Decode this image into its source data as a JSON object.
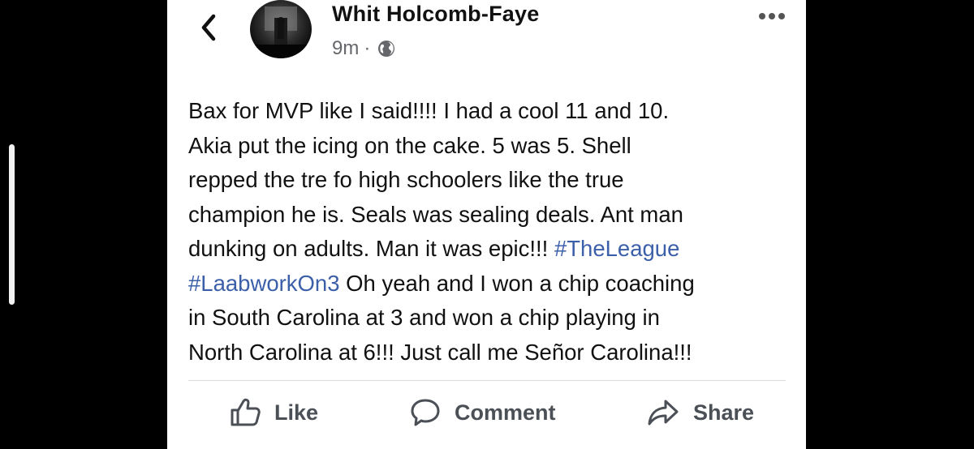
{
  "post": {
    "author": "Whit Holcomb-Faye",
    "time": "9m",
    "separator": "·",
    "lines": [
      [
        {
          "t": "Bax for MVP like I said!!!!  I had a cool 11 and 10."
        }
      ],
      [
        {
          "t": "Akia put the icing on the cake.  5 was 5. Shell"
        }
      ],
      [
        {
          "t": "repped the tre fo high schoolers like the true"
        }
      ],
      [
        {
          "t": "champion he is.  Seals was sealing deals. Ant man"
        }
      ],
      [
        {
          "t": "dunking on adults.  Man it was epic!!!  "
        },
        {
          "t": "#TheLeague",
          "tag": true
        }
      ],
      [
        {
          "t": "#LaabworkOn3",
          "tag": true
        },
        {
          "t": " Oh yeah and I won a chip coaching"
        }
      ],
      [
        {
          "t": "in South Carolina at 3 and won a chip playing in"
        }
      ],
      [
        {
          "t": "North Carolina at 6!!! Just call me Señor Carolina!!!"
        }
      ]
    ]
  },
  "actions": {
    "like": "Like",
    "comment": "Comment",
    "share": "Share"
  },
  "icons": {
    "back": "chevron-left-icon",
    "privacy": "globe-icon",
    "more": "more-horizontal-icon",
    "like": "thumbs-up-icon",
    "comment": "comment-bubble-icon",
    "share": "share-arrow-icon"
  },
  "colors": {
    "hashtag": "#3b5fa8",
    "meta": "#65676b",
    "action": "#4b4f56"
  }
}
